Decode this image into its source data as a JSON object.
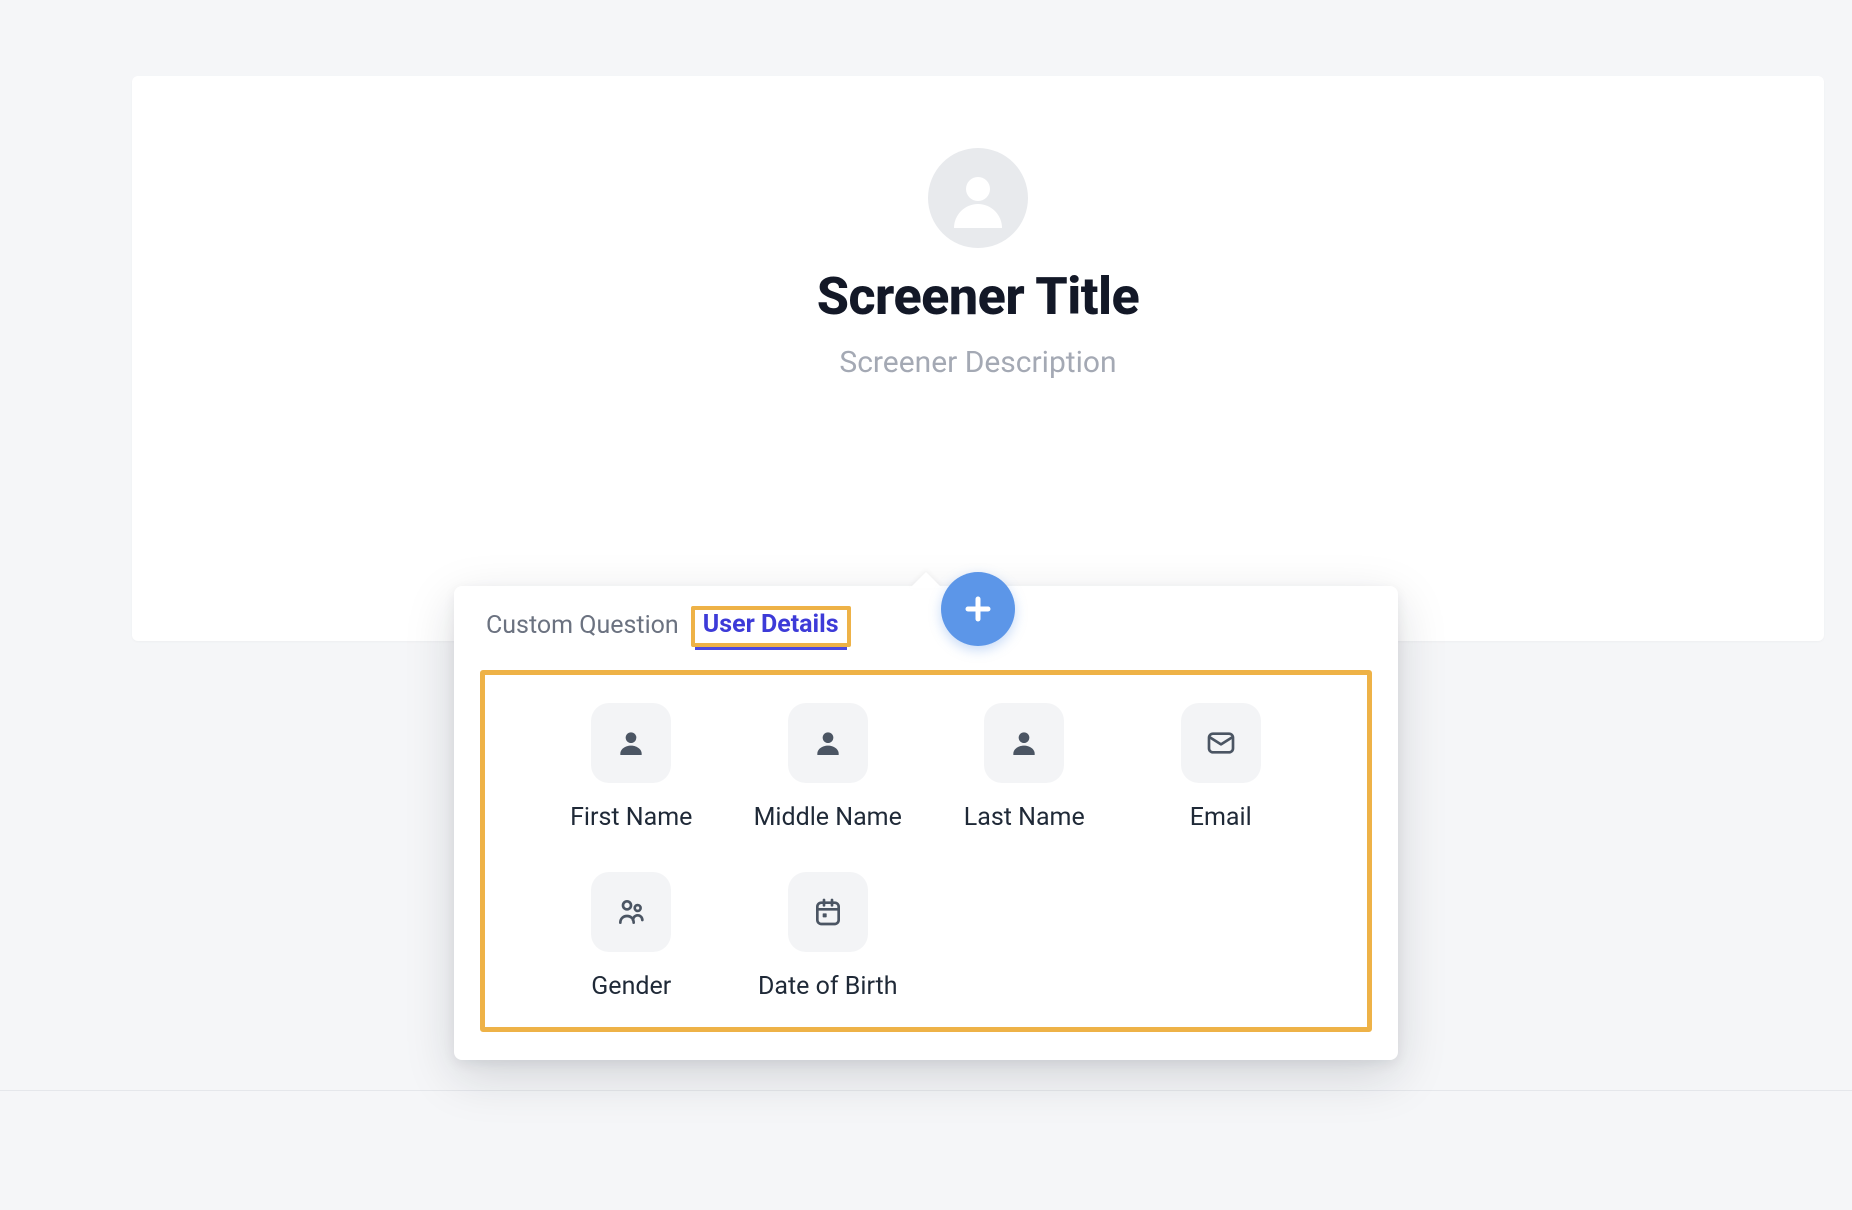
{
  "header": {
    "title": "Screener Title",
    "description": "Screener Description"
  },
  "popover": {
    "tabs": [
      {
        "label": "Custom Question",
        "active": false
      },
      {
        "label": "User Details",
        "active": true
      }
    ],
    "fields": [
      {
        "icon": "person-icon",
        "label": "First Name"
      },
      {
        "icon": "person-icon",
        "label": "Middle Name"
      },
      {
        "icon": "person-icon",
        "label": "Last Name"
      },
      {
        "icon": "email-icon",
        "label": "Email"
      },
      {
        "icon": "gender-icon",
        "label": "Gender"
      },
      {
        "icon": "calendar-icon",
        "label": "Date of Birth"
      }
    ]
  },
  "colors": {
    "accent": "#5c96e8",
    "highlight": "#eeb247",
    "tabActive": "#3d3bd8"
  }
}
